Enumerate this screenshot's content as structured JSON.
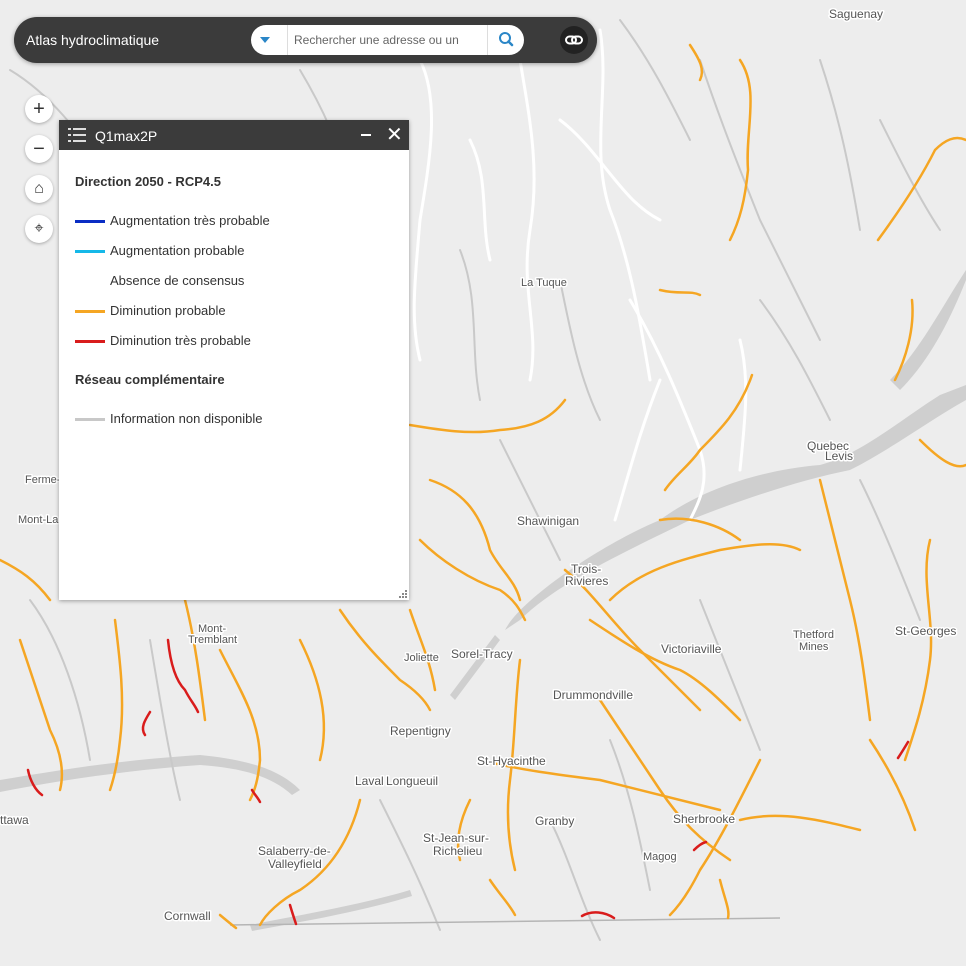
{
  "header": {
    "app_title": "Atlas hydroclimatique",
    "search_placeholder": "Rechercher une adresse ou un"
  },
  "tools": [
    {
      "name": "zoom-in",
      "glyph": "+"
    },
    {
      "name": "zoom-out",
      "glyph": "−"
    },
    {
      "name": "home",
      "glyph": "⌂"
    },
    {
      "name": "locate",
      "glyph": "⌖"
    }
  ],
  "legend": {
    "title": "Q1max2P",
    "section1_title": "Direction 2050 - RCP4.5",
    "items": [
      {
        "label": "Augmentation très probable",
        "color": "#0a2dc4"
      },
      {
        "label": "Augmentation probable",
        "color": "#15b8e8"
      },
      {
        "label": "Absence de consensus",
        "color": "#ffffff"
      },
      {
        "label": "Diminution probable",
        "color": "#f5a623"
      },
      {
        "label": "Diminution très probable",
        "color": "#d91c1c"
      }
    ],
    "section2_title": "Réseau complémentaire",
    "items2": [
      {
        "label": "Information non disponible",
        "color": "#c8c8c8"
      }
    ]
  },
  "map": {
    "places": [
      "Saguenay",
      "La Tuque",
      "Quebec",
      "Levis",
      "Ferme-",
      "Mont-La",
      "Shawinigan",
      "Trois-",
      "Rivieres",
      "Mont-",
      "Tremblant",
      "Joliette",
      "Sorel-Tracy",
      "Victoriaville",
      "Thetford",
      "Mines",
      "St-Georges",
      "Drummondville",
      "Repentigny",
      "St-Hyacinthe",
      "Laval",
      "Longueuil",
      "ttawa",
      "Salaberry-de-",
      "Valleyfield",
      "St-Jean-sur-",
      "Richelieu",
      "Granby",
      "Sherbrooke",
      "Magog",
      "Cornwall"
    ]
  }
}
